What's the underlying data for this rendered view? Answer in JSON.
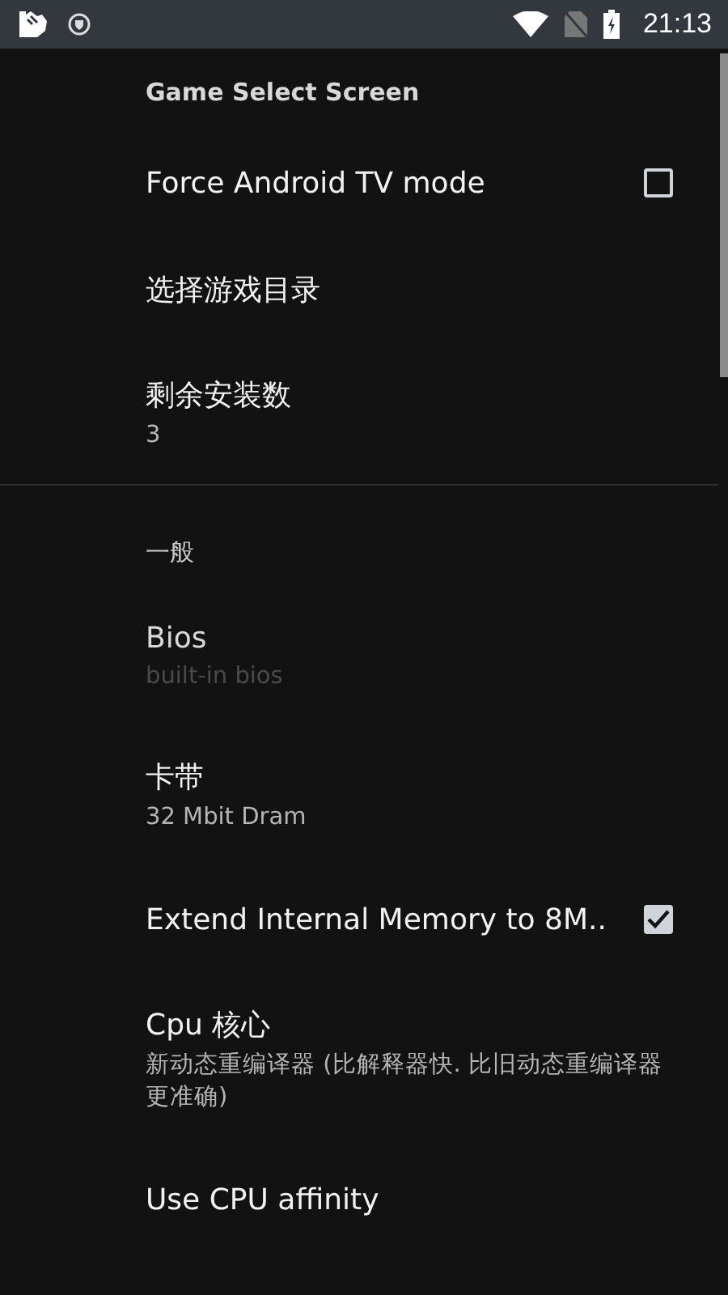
{
  "status_bar": {
    "time": "21:13"
  },
  "sections": [
    {
      "header": "Game Select Screen",
      "items": [
        {
          "kind": "checkbox",
          "title": "Force Android TV mode",
          "checked": false,
          "disabled": false
        },
        {
          "kind": "plain",
          "title": "选择游戏目录",
          "disabled": false
        },
        {
          "kind": "plain",
          "title": "剩余安装数",
          "summary": "3",
          "disabled": false
        }
      ]
    },
    {
      "header": "一般",
      "items": [
        {
          "kind": "plain",
          "title": "Bios",
          "summary": "built-in bios",
          "disabled": true
        },
        {
          "kind": "plain",
          "title": "卡带",
          "summary": "32 Mbit Dram",
          "disabled": false
        },
        {
          "kind": "checkbox",
          "title": "Extend Internal Memory to 8M..",
          "checked": true,
          "disabled": false
        },
        {
          "kind": "plain",
          "title": "Cpu 核心",
          "summary": "新动态重编译器 (比解释器快. 比旧动态重编译器更准确)",
          "disabled": false
        },
        {
          "kind": "plain",
          "title": "Use CPU affinity",
          "disabled": false
        }
      ]
    }
  ]
}
